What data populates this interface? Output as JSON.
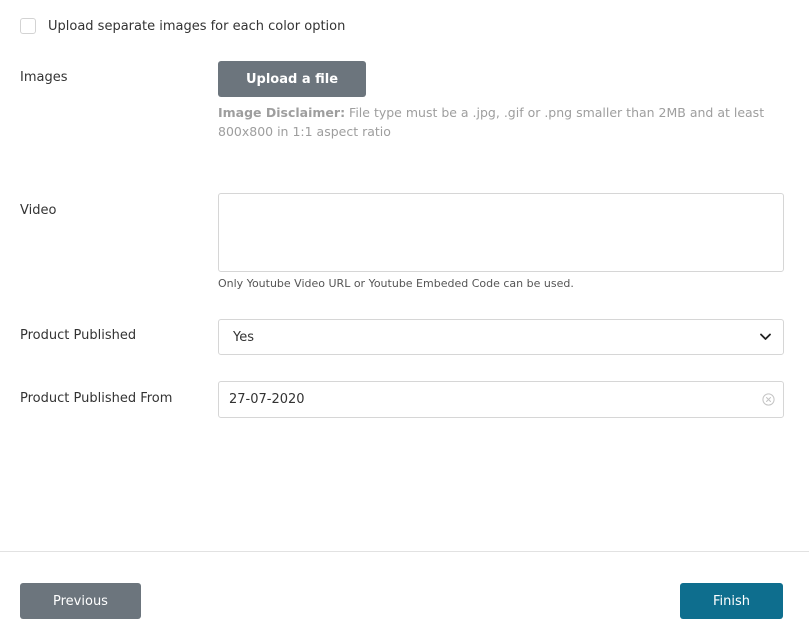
{
  "color_option": {
    "checkbox_label": "Upload separate images for each color option",
    "checked": false
  },
  "images": {
    "label": "Images",
    "upload_button": "Upload a file",
    "disclaimer_title": "Image Disclaimer:",
    "disclaimer_text": " File type must be a .jpg, .gif or .png smaller than 2MB and at least 800x800 in 1:1 aspect ratio"
  },
  "video": {
    "label": "Video",
    "value": "",
    "help_text": "Only Youtube Video URL or Youtube Embeded Code can be used."
  },
  "product_published": {
    "label": "Product Published",
    "selected": "Yes"
  },
  "product_published_from": {
    "label": "Product Published From",
    "value": "27-07-2020"
  },
  "footer": {
    "previous_label": "Previous",
    "finish_label": "Finish"
  },
  "colors": {
    "secondary_button": "#6c757d",
    "primary_button": "#0e6e8e",
    "border": "#d6d6d6",
    "muted_text": "#9e9e9e"
  },
  "icons": {
    "select_arrow": "chevron-down-icon",
    "date_clear": "clear-circle-icon"
  }
}
